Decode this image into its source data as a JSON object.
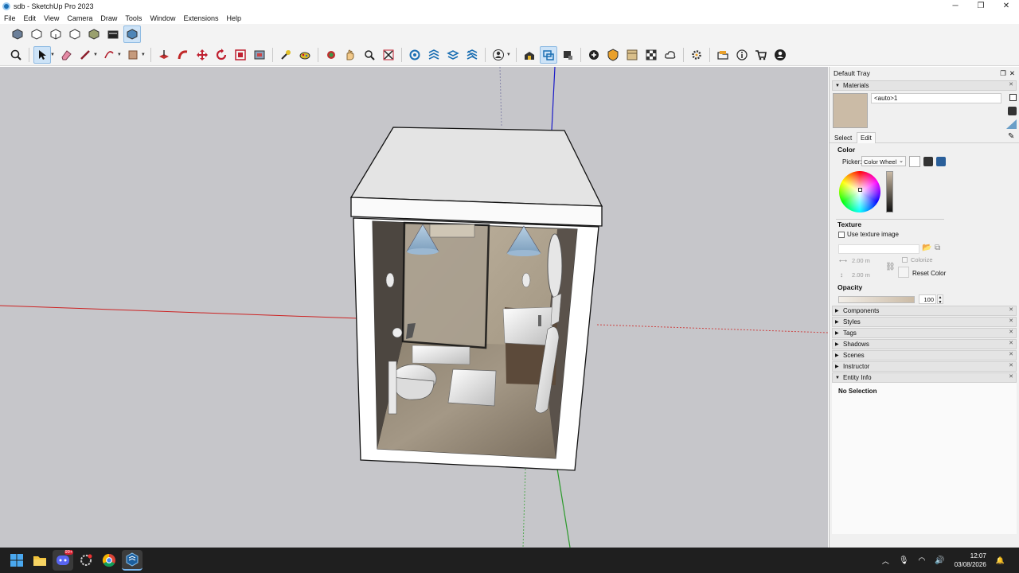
{
  "window": {
    "title": "sdb - SketchUp Pro 2023",
    "min": "─",
    "max": "❐",
    "close": "✕"
  },
  "menu": [
    "File",
    "Edit",
    "View",
    "Camera",
    "Draw",
    "Tools",
    "Window",
    "Extensions",
    "Help"
  ],
  "toolbar_views": [
    "iso-view-icon",
    "top-view-icon",
    "front-view-icon",
    "right-view-icon",
    "back-view-icon",
    "left-view-icon",
    "bottom-view-icon"
  ],
  "toolbar_main": [
    "zoom-icon",
    "select-icon",
    "eraser-icon",
    "pencil-line-icon",
    "arc-icon",
    "rectangle-icon",
    "push-pull-icon",
    "follow-me-icon",
    "move-icon",
    "rotate-icon",
    "scale-icon",
    "offset-icon",
    "tape-measure-icon",
    "paint-bucket-icon",
    "orbit-icon",
    "pan-icon",
    "zoom-window-icon",
    "zoom-extents-icon",
    "section-plane-icon",
    "section-display-icon",
    "section-cut-icon",
    "section-fill-icon",
    "user-icon",
    "warehouse-icon",
    "extension-icon",
    "component-icon",
    "add-location-icon",
    "geo-icon",
    "layout-icon",
    "checker-icon",
    "cloud-icon",
    "settings-icon",
    "folder-icon",
    "info-icon",
    "cart-icon",
    "account-icon"
  ],
  "tray": {
    "title": "Default Tray",
    "materials": {
      "label": "Materials",
      "name": "<auto>1",
      "swatch": "#cbbba6",
      "tab_select": "Select",
      "tab_edit": "Edit",
      "color_label": "Color",
      "picker_label": "Picker:",
      "picker_value": "Color Wheel",
      "texture_label": "Texture",
      "use_texture": "Use texture image",
      "width": "2.00 m",
      "height": "2.00 m",
      "colorize": "Colorize",
      "reset_color": "Reset Color",
      "opacity_label": "Opacity",
      "opacity_value": "100"
    },
    "panels": [
      "Components",
      "Styles",
      "Tags",
      "Shadows",
      "Scenes",
      "Instructor"
    ],
    "entity_info": {
      "label": "Entity Info",
      "value": "No Selection"
    }
  },
  "taskbar": {
    "time": "12:07",
    "date": "03/08/2026",
    "badge": "99+"
  }
}
